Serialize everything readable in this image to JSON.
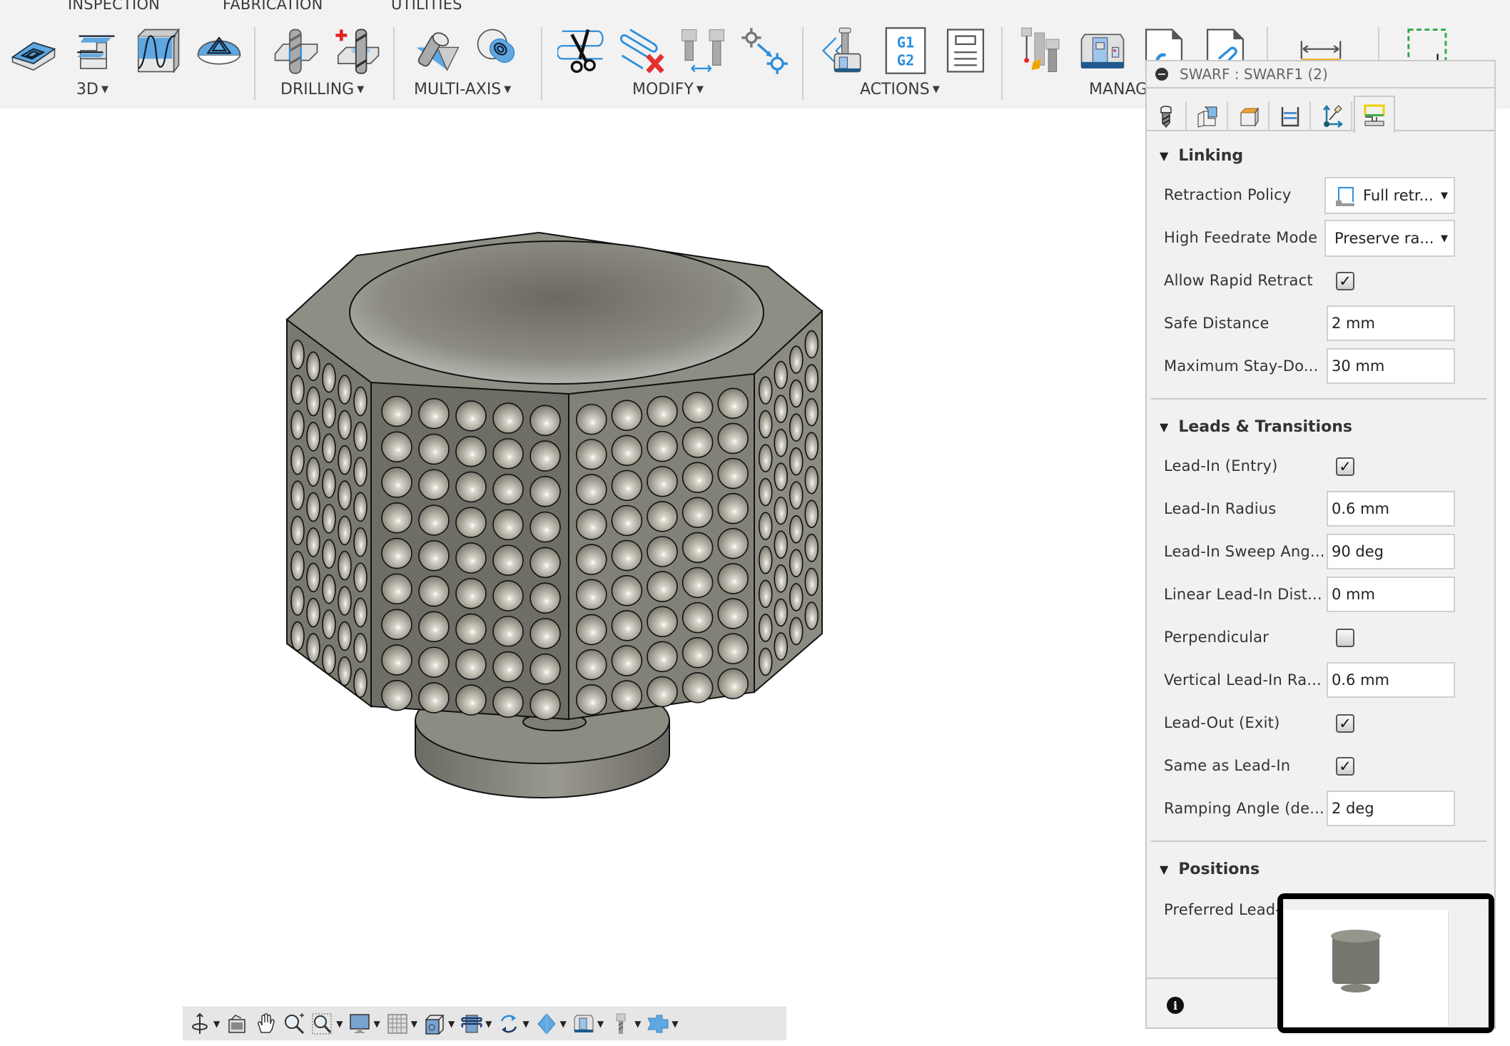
{
  "toolbar": {
    "top_tabs": [
      "INSPECTION",
      "FABRICATION",
      "UTILITIES"
    ],
    "groups": [
      {
        "label": "3D",
        "has_dropdown": true,
        "icons": [
          "adaptive-clearing-icon",
          "contour-icon",
          "scallop-icon",
          "morph-icon"
        ]
      },
      {
        "label": "DRILLING",
        "has_dropdown": true,
        "icons": [
          "drill-icon",
          "hole-recognition-icon"
        ]
      },
      {
        "label": "MULTI-AXIS",
        "has_dropdown": true,
        "icons": [
          "swarf-icon",
          "multi-axis-contour-icon"
        ]
      },
      {
        "label": "MODIFY",
        "has_dropdown": true,
        "icons": [
          "trim-icon",
          "delete-toolpath-icon",
          "tool-compare-icon",
          "move-point-icon"
        ]
      },
      {
        "label": "ACTIONS",
        "has_dropdown": true,
        "icons": [
          "simulate-icon",
          "post-process-icon",
          "setup-sheet-icon"
        ]
      },
      {
        "label": "MANAGE",
        "label_visible": "MANAG",
        "has_dropdown": false,
        "icons": [
          "tool-library-icon",
          "machine-library-icon",
          "template-library-icon",
          "post-library-icon"
        ]
      },
      {
        "label": "",
        "icons": [
          "measure-icon"
        ]
      },
      {
        "label": "",
        "icons": [
          "select-icon"
        ]
      }
    ]
  },
  "panel": {
    "title": "SWARF : SWARF1 (2)",
    "tabs": [
      {
        "name": "tool",
        "active": false
      },
      {
        "name": "geometry",
        "active": false
      },
      {
        "name": "heights",
        "active": false
      },
      {
        "name": "passes",
        "active": false
      },
      {
        "name": "multi-axis",
        "active": false
      },
      {
        "name": "linking",
        "active": true
      }
    ],
    "sections": {
      "linking": {
        "title": "Linking",
        "retraction_policy": {
          "label": "Retraction Policy",
          "value": "Full retr..."
        },
        "high_feedrate_mode": {
          "label": "High Feedrate Mode",
          "value": "Preserve ra..."
        },
        "allow_rapid_retract": {
          "label": "Allow Rapid Retract",
          "checked": true,
          "mark": "✓"
        },
        "safe_distance": {
          "label": "Safe Distance",
          "value": "2 mm"
        },
        "max_stay_down": {
          "label": "Maximum Stay-Do...",
          "value": "30 mm"
        }
      },
      "leads": {
        "title": "Leads & Transitions",
        "lead_in": {
          "label": "Lead-In (Entry)",
          "checked": true,
          "mark": "✓"
        },
        "lead_in_radius": {
          "label": "Lead-In Radius",
          "value": "0.6 mm"
        },
        "lead_in_sweep": {
          "label": "Lead-In Sweep Ang...",
          "value": "90 deg"
        },
        "linear_lead_in": {
          "label": "Linear Lead-In Dist...",
          "value": "0 mm"
        },
        "perpendicular": {
          "label": "Perpendicular",
          "checked": false,
          "mark": ""
        },
        "vertical_lead_in": {
          "label": "Vertical Lead-In Ra...",
          "value": "0.6 mm"
        },
        "lead_out": {
          "label": "Lead-Out (Exit)",
          "checked": true,
          "mark": "✓"
        },
        "same_as_lead_in": {
          "label": "Same as Lead-In",
          "checked": true,
          "mark": "✓"
        },
        "ramping_angle": {
          "label": "Ramping Angle (de...",
          "value": "2 deg"
        }
      },
      "positions": {
        "title": "Positions",
        "preferred_lead": {
          "label": "Preferred Lead-"
        }
      }
    },
    "footer": {
      "info_glyph": "i"
    }
  },
  "navbar": {
    "items": [
      {
        "name": "orbit-icon",
        "dropdown": true
      },
      {
        "name": "look-at-icon",
        "dropdown": false
      },
      {
        "name": "pan-icon",
        "dropdown": false
      },
      {
        "name": "zoom-icon",
        "dropdown": false
      },
      {
        "name": "zoom-window-icon",
        "dropdown": true
      },
      {
        "name": "display-settings-icon",
        "dropdown": true
      },
      {
        "name": "grid-icon",
        "dropdown": true
      },
      {
        "name": "viewports-icon",
        "dropdown": true
      },
      {
        "name": "toolpath-display-icon",
        "dropdown": true
      },
      {
        "name": "simulation-refresh-icon",
        "dropdown": true
      },
      {
        "name": "stock-display-icon",
        "dropdown": true
      },
      {
        "name": "machine-display-icon",
        "dropdown": true
      },
      {
        "name": "tool-display-icon",
        "dropdown": true
      },
      {
        "name": "workflow-icon",
        "dropdown": true
      }
    ],
    "caret": "▼"
  },
  "glyphs": {
    "caret": "▼",
    "section_open": "▼"
  },
  "colors": {
    "toolbar_bg": "#f2f2f2",
    "panel_bg": "#f1f1f1",
    "model_body": "#86847a",
    "model_dark": "#5f5d55",
    "accent_blue": "#3b8fd9"
  }
}
